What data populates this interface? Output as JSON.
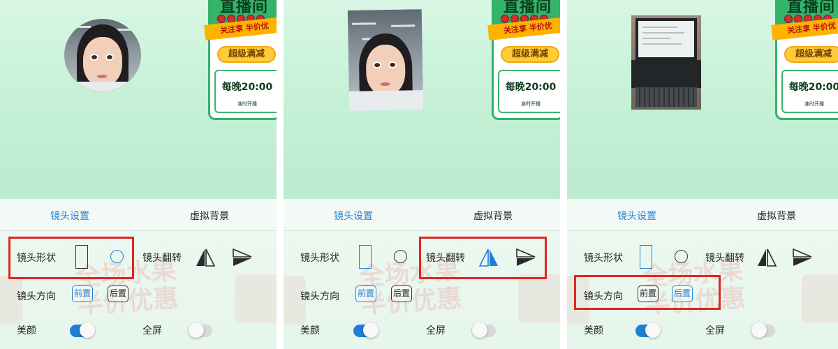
{
  "promo": {
    "title": "直播间",
    "ribbon": "关注享 半价优",
    "pill": "超级满减",
    "time": "每晚20:00",
    "sub": "准时开播"
  },
  "settings": {
    "tab_camera": "镜头设置",
    "tab_background": "虚拟背景",
    "shape_label": "镜头形状",
    "flip_label": "镜头翻转",
    "direction_label": "镜头方向",
    "front_label": "前置",
    "back_label": "后置",
    "beauty_label": "美颜",
    "fullscreen_label": "全屏"
  },
  "watermark": {
    "line1": "全场水果",
    "line2": "半价优惠"
  },
  "panels": [
    {
      "shape": "circle",
      "flip": "none",
      "direction": "front",
      "beauty": true,
      "fullscreen": false,
      "highlight": "shape"
    },
    {
      "shape": "rect",
      "flip": "horizontal",
      "direction": "front",
      "beauty": true,
      "fullscreen": false,
      "highlight": "flip"
    },
    {
      "shape": "rect",
      "flip": "none",
      "direction": "back",
      "beauty": true,
      "fullscreen": false,
      "highlight": "direction"
    }
  ],
  "colors": {
    "accent": "#1f7fd6",
    "highlight": "#e0261f",
    "stage_bg": "#c4f0d5",
    "promo_green": "#34b36b"
  }
}
